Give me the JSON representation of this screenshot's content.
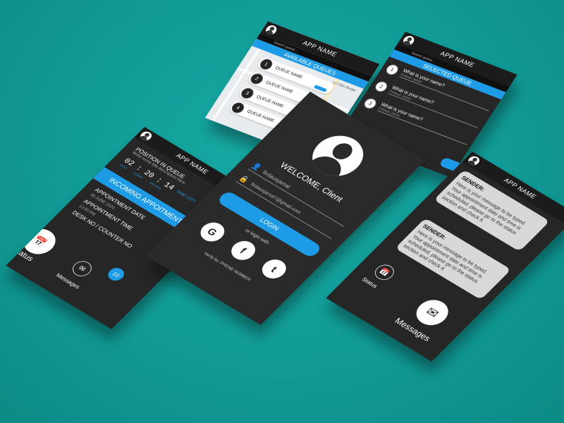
{
  "app": {
    "title": "APP NAME",
    "search_hint": "Search queue..."
  },
  "queues_screen": {
    "header": "AVAILABLE QUEUES",
    "items": [
      {
        "num": "1",
        "label": "QUEUE NAME"
      },
      {
        "num": "2",
        "label": "QUEUE NAME"
      },
      {
        "num": "3",
        "label": "QUEUE NAME"
      },
      {
        "num": "4",
        "label": "QUEUE NAME"
      }
    ],
    "map_label": "La Cielo Burger"
  },
  "selected_screen": {
    "header": "SELECTED QUEUE",
    "items": [
      {
        "num": "1",
        "question": "What is your name?",
        "answer": "Firdaus Jamal"
      },
      {
        "num": "2",
        "question": "What is your name?",
        "answer": "Firdaus Jamal"
      },
      {
        "num": "3",
        "question": "What is your name?",
        "answer": "Firdaus Jamal"
      }
    ]
  },
  "status_screen": {
    "position_title": "POSITION IN QUEUE",
    "position_desc": "Write some title description here.",
    "time_left_label": "TIME LEFT",
    "time": {
      "days": "02",
      "hours": "20",
      "minutes": "14"
    },
    "time_units": {
      "days": "DAYS",
      "hours": "HOURS",
      "minutes": "MINUTES"
    },
    "position": "14",
    "incoming_label": "INCOMING APPOITMENT",
    "appointment_date_label": "APPOINTMENT DATE",
    "appointment_date": "30 JUNE 2020",
    "appointment_time_label": "APPOINTMENT TIME",
    "appointment_time": "12:00 PM",
    "desk_label": "DESK NO / COUNTER NO",
    "desk_no": "10",
    "nav_status": "Status",
    "nav_messages": "Messages"
  },
  "login_screen": {
    "welcome": "WELCOME, Client",
    "username": "firdausjamal",
    "email": "firdausjamal7@gmail.com",
    "login_button": "LOGIN",
    "or_login": "or login with",
    "verify": "Verify by: PHONE NUMBER",
    "socials": [
      "G",
      "f",
      "t"
    ]
  },
  "messages_screen": {
    "messages": [
      {
        "sender": "SENDER:",
        "text": "Here is your message to be typed. Your appointment date and time is scheduled, please go to the status section and check it."
      },
      {
        "sender": "SENDER:",
        "text": "Here is your message to be typed. Your appointment date and time is scheduled, please go to the status section and check it."
      }
    ],
    "nav_status": "Status",
    "nav_messages": "Messages"
  },
  "colors": {
    "accent": "#1e9be6",
    "background": "#119a96",
    "screen": "#262626"
  }
}
